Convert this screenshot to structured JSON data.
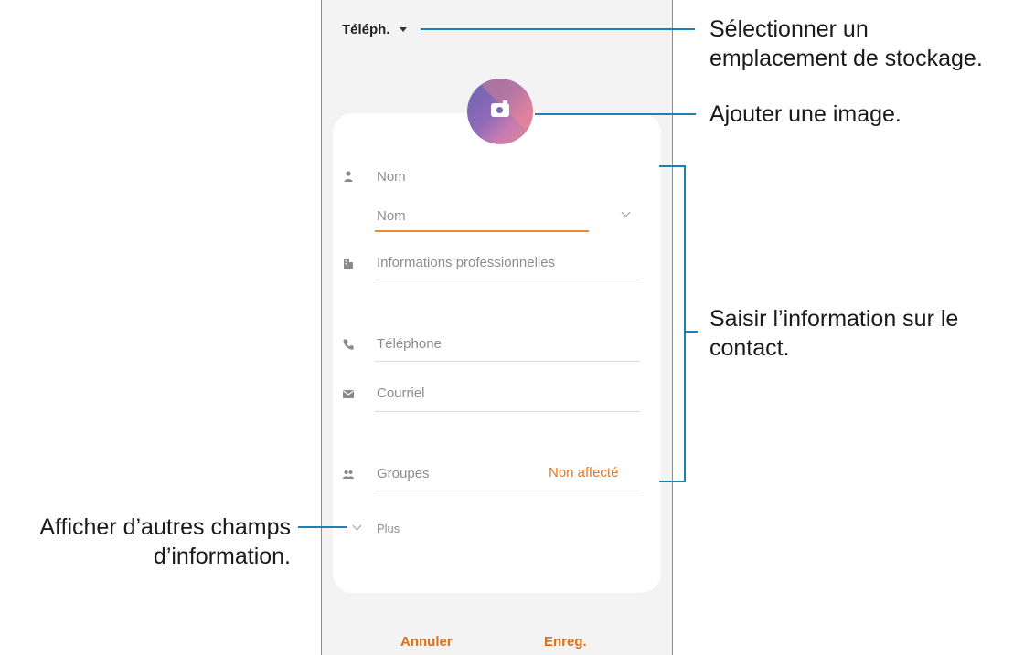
{
  "header": {
    "storage_label": "Téléph."
  },
  "form": {
    "name_section_label": "Nom",
    "name_field_value": "Nom",
    "organization_label": "Informations professionnelles",
    "phone_label": "Téléphone",
    "email_label": "Courriel",
    "groups_label": "Groupes",
    "groups_value": "Non affecté",
    "more_label": "Plus"
  },
  "footer": {
    "cancel_label": "Annuler",
    "save_label": "Enreg."
  },
  "callouts": {
    "storage_line1": "Sélectionner un",
    "storage_line2": "emplacement de stockage.",
    "image": "Ajouter une image.",
    "info_line1": "Saisir l’information sur le",
    "info_line2": "contact.",
    "more_line1": "Afficher d’autres champs",
    "more_line2": "d’information."
  },
  "icons": {
    "storage_caret": "caret-down-icon",
    "photo": "camera-icon",
    "name": "person-icon",
    "organization": "building-icon",
    "phone": "phone-icon",
    "email": "envelope-icon",
    "groups": "group-icon",
    "more": "chevron-down-icon"
  },
  "colors": {
    "accent_orange": "#e5761d",
    "callout_line_blue": "#1f7fb7",
    "photo_gradient_start": "#6a64b0",
    "photo_gradient_end": "#e0878f"
  }
}
